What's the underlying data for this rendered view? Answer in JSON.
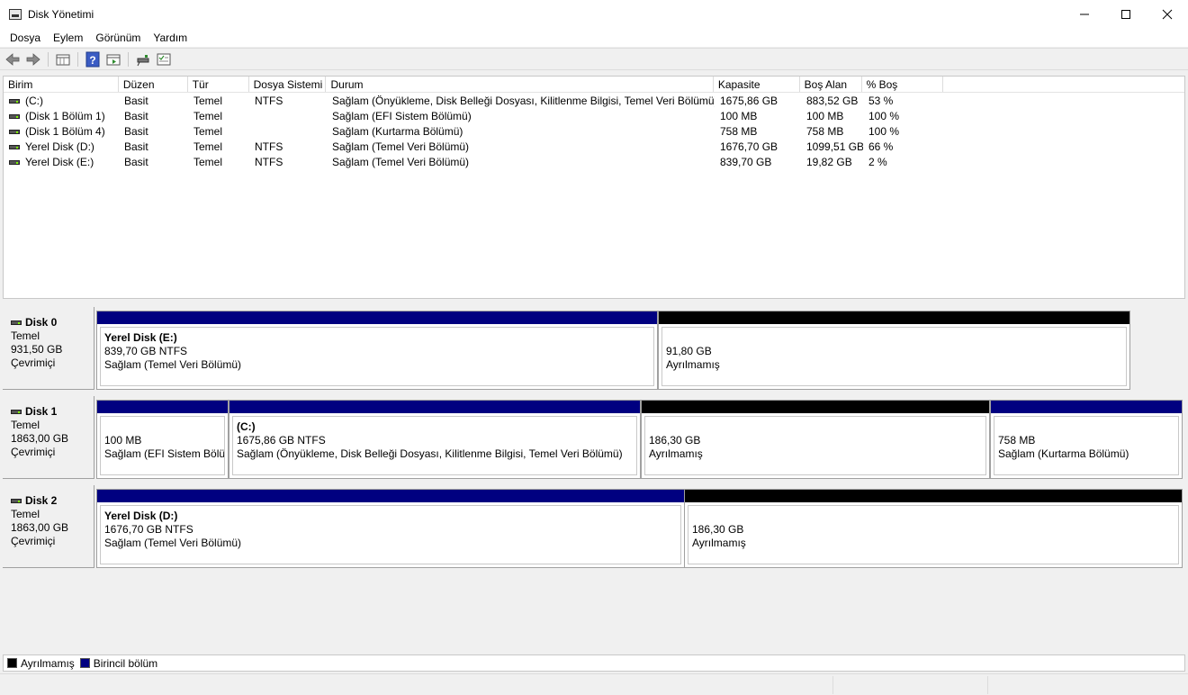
{
  "window": {
    "title": "Disk Yönetimi",
    "minimize_icon": "minimize-icon",
    "maximize_icon": "maximize-icon",
    "close_icon": "close-icon"
  },
  "menu": [
    "Dosya",
    "Eylem",
    "Görünüm",
    "Yardım"
  ],
  "toolbar": {
    "icons": [
      "back-icon",
      "forward-icon",
      "volume-list-icon",
      "help-icon",
      "properties-icon",
      "connect-icon",
      "rescan-icon"
    ]
  },
  "volume_list": {
    "columns": [
      "Birim",
      "Düzen",
      "Tür",
      "Dosya Sistemi",
      "Durum",
      "Kapasite",
      "Boş Alan",
      "% Boş",
      ""
    ],
    "rows": [
      [
        "(C:)",
        "Basit",
        "Temel",
        "NTFS",
        "Sağlam (Önyükleme, Disk Belleği Dosyası, Kilitlenme Bilgisi, Temel Veri Bölümü)",
        "1675,86 GB",
        "883,52 GB",
        "53 %"
      ],
      [
        "(Disk 1 Bölüm 1)",
        "Basit",
        "Temel",
        "",
        "Sağlam (EFI Sistem Bölümü)",
        "100 MB",
        "100 MB",
        "100 %"
      ],
      [
        "(Disk 1 Bölüm 4)",
        "Basit",
        "Temel",
        "",
        "Sağlam (Kurtarma Bölümü)",
        "758 MB",
        "758 MB",
        "100 %"
      ],
      [
        "Yerel Disk (D:)",
        "Basit",
        "Temel",
        "NTFS",
        "Sağlam (Temel Veri Bölümü)",
        "1676,70 GB",
        "1099,51 GB",
        "66 %"
      ],
      [
        "Yerel Disk (E:)",
        "Basit",
        "Temel",
        "NTFS",
        "Sağlam (Temel Veri Bölümü)",
        "839,70 GB",
        "19,82 GB",
        "2 %"
      ]
    ]
  },
  "disks": [
    {
      "name": "Disk 0",
      "type": "Temel",
      "size": "931,50 GB",
      "state": "Çevrimiçi",
      "partitions": [
        {
          "kind": "primary",
          "name": "Yerel Disk  (E:)",
          "size": "839,70 GB NTFS",
          "status": "Sağlam (Temel Veri Bölümü)"
        },
        {
          "kind": "unalloc",
          "name": "",
          "size": "91,80 GB",
          "status": "Ayrılmamış"
        }
      ]
    },
    {
      "name": "Disk 1",
      "type": "Temel",
      "size": "1863,00 GB",
      "state": "Çevrimiçi",
      "partitions": [
        {
          "kind": "primary",
          "name": "",
          "size": "100 MB",
          "status": "Sağlam (EFI Sistem Bölür"
        },
        {
          "kind": "primary",
          "name": "(C:)",
          "size": "1675,86 GB NTFS",
          "status": "Sağlam (Önyükleme, Disk Belleği Dosyası, Kilitlenme Bilgisi, Temel Veri Bölümü)"
        },
        {
          "kind": "unalloc",
          "name": "",
          "size": "186,30 GB",
          "status": "Ayrılmamış"
        },
        {
          "kind": "primary",
          "name": "",
          "size": "758 MB",
          "status": "Sağlam (Kurtarma Bölümü)"
        }
      ]
    },
    {
      "name": "Disk 2",
      "type": "Temel",
      "size": "1863,00 GB",
      "state": "Çevrimiçi",
      "partitions": [
        {
          "kind": "primary",
          "name": "Yerel Disk  (D:)",
          "size": "1676,70 GB NTFS",
          "status": "Sağlam (Temel Veri Bölümü)"
        },
        {
          "kind": "unalloc",
          "name": "",
          "size": "186,30 GB",
          "status": "Ayrılmamış"
        }
      ]
    }
  ],
  "legend": {
    "unallocated": "Ayrılmamış",
    "primary": "Birincil bölüm",
    "unallocated_color": "#000000",
    "primary_color": "#000080"
  }
}
